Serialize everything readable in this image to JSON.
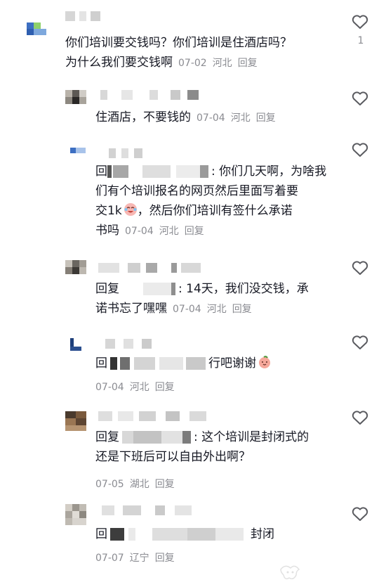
{
  "comments": [
    {
      "text_lines": [
        "你们培训要交钱吗？你们培训是住酒店吗？",
        "为什么我们要交钱啊"
      ],
      "date": "07-02",
      "location": "河北",
      "reply_label": "回复",
      "like_count": "1"
    },
    {
      "text_lines": [
        "住酒店，不要钱的"
      ],
      "date": "07-04",
      "location": "河北",
      "reply_label": "回复"
    },
    {
      "prefix": "回",
      "text_lines": [
        ": 你们几天啊，为啥我",
        "们有个培训报名的网页然后里面写着要",
        "交1k",
        "，然后你们培训有签什么承诺",
        "书吗"
      ],
      "date": "07-04",
      "location": "河北",
      "reply_label": "回复"
    },
    {
      "prefix": "回复",
      "text_lines": [
        ": 14天，我们没交钱，承",
        "诺书忘了嘿嘿"
      ],
      "date": "07-04",
      "location": "河北",
      "reply_label": "回复"
    },
    {
      "prefix": "回",
      "text_lines": [
        "行吧谢谢"
      ],
      "date": "07-04",
      "location": "河北",
      "reply_label": "回复"
    },
    {
      "prefix": "回复",
      "text_lines": [
        ": 这个培训是封闭式的",
        "还是下班后可以自由外出啊？"
      ],
      "date": "07-05",
      "location": "湖北",
      "reply_label": "回复"
    },
    {
      "prefix": "回",
      "text_lines": [
        "封闭"
      ],
      "date": "07-07",
      "location": "辽宁",
      "reply_label": "回复"
    }
  ],
  "colors": {
    "meta": "#8a8b91",
    "text": "#161823",
    "avatar_blue": "#3d6fc2",
    "avatar_green": "#8fd16a"
  },
  "icons": [
    "heart-outline-icon",
    "laughing-crying-emoji-icon",
    "peach-emoji-icon",
    "watermark-icon"
  ]
}
